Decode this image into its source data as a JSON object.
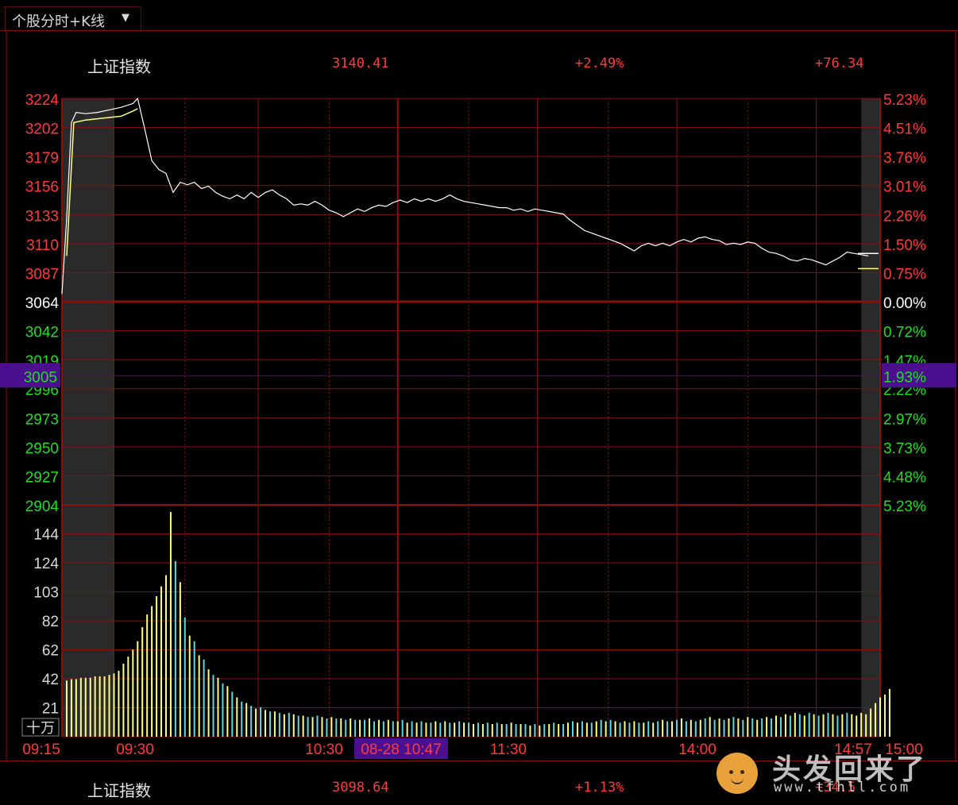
{
  "tab": {
    "label": "个股分时+K线",
    "caret": "▼"
  },
  "header": {
    "name": "上证指数",
    "price": "3140.41",
    "pct": "+2.49%",
    "change": "+76.34"
  },
  "footer": {
    "name": "上证指数",
    "price": "3098.64",
    "pct": "+1.13%",
    "change": "+34.5"
  },
  "watermark": {
    "text": "头发回来了",
    "url": "www.tfhll.com"
  },
  "colors": {
    "up": "#ff3b3b",
    "down": "#22dd22",
    "grid": "#8a1010",
    "price_line": "#ffffff",
    "avg_line": "#ffff80",
    "vol_up": "#ffff80",
    "vol_down": "#5fd7e0",
    "cursor_bg": "#4b0f8f",
    "shade": "#2a2a2a"
  },
  "chart_data": {
    "type": "line",
    "title": "上证指数",
    "prev_close": 3064,
    "y_ticks_up": [
      "3224",
      "3202",
      "3179",
      "3156",
      "3133",
      "3110",
      "3087"
    ],
    "y_tick_mid": "3064",
    "y_ticks_down": [
      "3042",
      "3019",
      "2996",
      "2973",
      "2950",
      "2927",
      "2904"
    ],
    "pct_ticks_up": [
      "5.23%",
      "4.51%",
      "3.76%",
      "3.01%",
      "2.26%",
      "1.50%",
      "0.75%"
    ],
    "pct_tick_mid": "0.00%",
    "pct_ticks_down": [
      "0.72%",
      "1.47%",
      "2.22%",
      "2.97%",
      "3.73%",
      "4.48%",
      "5.23%"
    ],
    "vol_ticks": [
      "144",
      "124",
      "103",
      "82",
      "62",
      "42",
      "21"
    ],
    "vol_unit": "十万",
    "x_ticks": [
      "09:15",
      "09:30",
      "10:30",
      "11:30",
      "14:00",
      "14:57",
      "15:00"
    ],
    "cursor": {
      "price_label": "3005",
      "pct_label": "1.93%",
      "time_label": "08-28 10:47"
    },
    "price_series": [
      [
        0,
        3070
      ],
      [
        2,
        3130
      ],
      [
        4,
        3205
      ],
      [
        6,
        3213
      ],
      [
        10,
        3212
      ],
      [
        15,
        3213
      ],
      [
        20,
        3215
      ],
      [
        25,
        3217
      ],
      [
        30,
        3220
      ],
      [
        32,
        3224
      ],
      [
        35,
        3200
      ],
      [
        38,
        3175
      ],
      [
        41,
        3168
      ],
      [
        44,
        3165
      ],
      [
        47,
        3150
      ],
      [
        50,
        3158
      ],
      [
        53,
        3156
      ],
      [
        56,
        3158
      ],
      [
        59,
        3153
      ],
      [
        62,
        3155
      ],
      [
        65,
        3150
      ],
      [
        68,
        3147
      ],
      [
        71,
        3145
      ],
      [
        74,
        3148
      ],
      [
        77,
        3145
      ],
      [
        80,
        3150
      ],
      [
        83,
        3146
      ],
      [
        86,
        3150
      ],
      [
        89,
        3152
      ],
      [
        92,
        3148
      ],
      [
        95,
        3145
      ],
      [
        98,
        3140
      ],
      [
        101,
        3141
      ],
      [
        104,
        3140
      ],
      [
        107,
        3143
      ],
      [
        110,
        3140
      ],
      [
        113,
        3136
      ],
      [
        116,
        3134
      ],
      [
        119,
        3131
      ],
      [
        122,
        3134
      ],
      [
        125,
        3137
      ],
      [
        128,
        3135
      ],
      [
        131,
        3138
      ],
      [
        134,
        3140
      ],
      [
        137,
        3139
      ],
      [
        140,
        3142
      ],
      [
        143,
        3144
      ],
      [
        146,
        3142
      ],
      [
        149,
        3145
      ],
      [
        152,
        3143
      ],
      [
        155,
        3145
      ],
      [
        158,
        3143
      ],
      [
        161,
        3145
      ],
      [
        164,
        3148
      ],
      [
        167,
        3145
      ],
      [
        170,
        3143
      ],
      [
        173,
        3142
      ],
      [
        176,
        3141
      ],
      [
        179,
        3140
      ],
      [
        182,
        3139
      ],
      [
        185,
        3138
      ],
      [
        188,
        3138
      ],
      [
        191,
        3136
      ],
      [
        194,
        3137
      ],
      [
        197,
        3135
      ],
      [
        200,
        3137
      ],
      [
        203,
        3136
      ],
      [
        206,
        3135
      ],
      [
        209,
        3134
      ],
      [
        212,
        3133
      ],
      [
        215,
        3128
      ],
      [
        218,
        3124
      ],
      [
        221,
        3120
      ],
      [
        224,
        3118
      ],
      [
        227,
        3116
      ],
      [
        230,
        3114
      ],
      [
        233,
        3112
      ],
      [
        236,
        3110
      ],
      [
        239,
        3107
      ],
      [
        242,
        3104
      ],
      [
        245,
        3108
      ],
      [
        248,
        3110
      ],
      [
        251,
        3108
      ],
      [
        254,
        3110
      ],
      [
        257,
        3108
      ],
      [
        260,
        3111
      ],
      [
        263,
        3113
      ],
      [
        266,
        3111
      ],
      [
        269,
        3114
      ],
      [
        272,
        3115
      ],
      [
        275,
        3113
      ],
      [
        278,
        3112
      ],
      [
        281,
        3109
      ],
      [
        284,
        3110
      ],
      [
        287,
        3109
      ],
      [
        290,
        3111
      ],
      [
        293,
        3110
      ],
      [
        296,
        3106
      ],
      [
        299,
        3103
      ],
      [
        302,
        3102
      ],
      [
        305,
        3100
      ],
      [
        308,
        3097
      ],
      [
        311,
        3096
      ],
      [
        314,
        3098
      ],
      [
        317,
        3097
      ],
      [
        320,
        3095
      ],
      [
        323,
        3093
      ],
      [
        326,
        3096
      ],
      [
        329,
        3099
      ],
      [
        332,
        3103
      ],
      [
        335,
        3102
      ],
      [
        338,
        3101
      ],
      [
        341,
        3100
      ]
    ],
    "avg_series": [
      [
        2,
        3100
      ],
      [
        5,
        3205
      ],
      [
        10,
        3207
      ],
      [
        15,
        3208
      ],
      [
        20,
        3209
      ],
      [
        25,
        3210
      ],
      [
        30,
        3214
      ],
      [
        32,
        3216
      ]
    ],
    "volume": [
      [
        2,
        40
      ],
      [
        4,
        41
      ],
      [
        6,
        41
      ],
      [
        8,
        42
      ],
      [
        10,
        42
      ],
      [
        12,
        42
      ],
      [
        14,
        43
      ],
      [
        16,
        43
      ],
      [
        18,
        43
      ],
      [
        20,
        44
      ],
      [
        22,
        45
      ],
      [
        24,
        47
      ],
      [
        26,
        52
      ],
      [
        28,
        57
      ],
      [
        30,
        62
      ],
      [
        32,
        68
      ],
      [
        34,
        78
      ],
      [
        36,
        87
      ],
      [
        38,
        93
      ],
      [
        40,
        100
      ],
      [
        42,
        107
      ],
      [
        44,
        115
      ],
      [
        46,
        160
      ],
      [
        48,
        125
      ],
      [
        50,
        110
      ],
      [
        52,
        85
      ],
      [
        54,
        72
      ],
      [
        56,
        68
      ],
      [
        58,
        58
      ],
      [
        60,
        55
      ],
      [
        62,
        48
      ],
      [
        64,
        44
      ],
      [
        66,
        42
      ],
      [
        68,
        38
      ],
      [
        70,
        36
      ],
      [
        72,
        32
      ],
      [
        74,
        28
      ],
      [
        76,
        25
      ],
      [
        78,
        24
      ],
      [
        80,
        22
      ],
      [
        82,
        20
      ],
      [
        84,
        21
      ],
      [
        86,
        19
      ],
      [
        88,
        18
      ],
      [
        90,
        18
      ],
      [
        92,
        17
      ],
      [
        94,
        16
      ],
      [
        96,
        17
      ],
      [
        98,
        16
      ],
      [
        100,
        15
      ],
      [
        102,
        15
      ],
      [
        104,
        14
      ],
      [
        106,
        14
      ],
      [
        108,
        15
      ],
      [
        110,
        14
      ],
      [
        112,
        13
      ],
      [
        114,
        14
      ],
      [
        116,
        13
      ],
      [
        118,
        13
      ],
      [
        120,
        12
      ],
      [
        122,
        13
      ],
      [
        124,
        12
      ],
      [
        126,
        12
      ],
      [
        128,
        12
      ],
      [
        130,
        13
      ],
      [
        132,
        11
      ],
      [
        134,
        12
      ],
      [
        136,
        11
      ],
      [
        138,
        12
      ],
      [
        140,
        11
      ],
      [
        142,
        11
      ],
      [
        144,
        12
      ],
      [
        146,
        10
      ],
      [
        148,
        11
      ],
      [
        150,
        10
      ],
      [
        152,
        11
      ],
      [
        154,
        10
      ],
      [
        156,
        10
      ],
      [
        158,
        11
      ],
      [
        160,
        10
      ],
      [
        162,
        11
      ],
      [
        164,
        10
      ],
      [
        166,
        10
      ],
      [
        168,
        11
      ],
      [
        170,
        10
      ],
      [
        172,
        10
      ],
      [
        174,
        9
      ],
      [
        176,
        10
      ],
      [
        178,
        9
      ],
      [
        180,
        10
      ],
      [
        182,
        9
      ],
      [
        184,
        10
      ],
      [
        186,
        9
      ],
      [
        188,
        9
      ],
      [
        190,
        10
      ],
      [
        192,
        9
      ],
      [
        194,
        9
      ],
      [
        196,
        9
      ],
      [
        198,
        8
      ],
      [
        200,
        9
      ],
      [
        202,
        8
      ],
      [
        204,
        9
      ],
      [
        206,
        9
      ],
      [
        208,
        10
      ],
      [
        210,
        9
      ],
      [
        212,
        9
      ],
      [
        214,
        10
      ],
      [
        216,
        11
      ],
      [
        218,
        10
      ],
      [
        220,
        11
      ],
      [
        222,
        10
      ],
      [
        224,
        10
      ],
      [
        226,
        11
      ],
      [
        228,
        12
      ],
      [
        230,
        11
      ],
      [
        232,
        12
      ],
      [
        234,
        11
      ],
      [
        236,
        10
      ],
      [
        238,
        11
      ],
      [
        240,
        10
      ],
      [
        242,
        11
      ],
      [
        244,
        10
      ],
      [
        246,
        10
      ],
      [
        248,
        11
      ],
      [
        250,
        10
      ],
      [
        252,
        11
      ],
      [
        254,
        12
      ],
      [
        256,
        11
      ],
      [
        258,
        11
      ],
      [
        260,
        12
      ],
      [
        262,
        13
      ],
      [
        264,
        11
      ],
      [
        266,
        12
      ],
      [
        268,
        11
      ],
      [
        270,
        12
      ],
      [
        272,
        13
      ],
      [
        274,
        14
      ],
      [
        276,
        12
      ],
      [
        278,
        13
      ],
      [
        280,
        12
      ],
      [
        282,
        13
      ],
      [
        284,
        14
      ],
      [
        286,
        13
      ],
      [
        288,
        12
      ],
      [
        290,
        14
      ],
      [
        292,
        13
      ],
      [
        294,
        12
      ],
      [
        296,
        13
      ],
      [
        298,
        14
      ],
      [
        300,
        13
      ],
      [
        302,
        15
      ],
      [
        304,
        14
      ],
      [
        306,
        16
      ],
      [
        308,
        15
      ],
      [
        310,
        17
      ],
      [
        312,
        16
      ],
      [
        314,
        15
      ],
      [
        316,
        17
      ],
      [
        318,
        16
      ],
      [
        320,
        15
      ],
      [
        322,
        16
      ],
      [
        324,
        17
      ],
      [
        326,
        16
      ],
      [
        328,
        15
      ],
      [
        330,
        16
      ],
      [
        332,
        17
      ],
      [
        334,
        16
      ],
      [
        336,
        15
      ],
      [
        338,
        17
      ],
      [
        340,
        16
      ],
      [
        342,
        20
      ],
      [
        344,
        24
      ],
      [
        346,
        28
      ],
      [
        348,
        30
      ],
      [
        350,
        34
      ]
    ],
    "vol_ylim": [
      0,
      165
    ]
  }
}
